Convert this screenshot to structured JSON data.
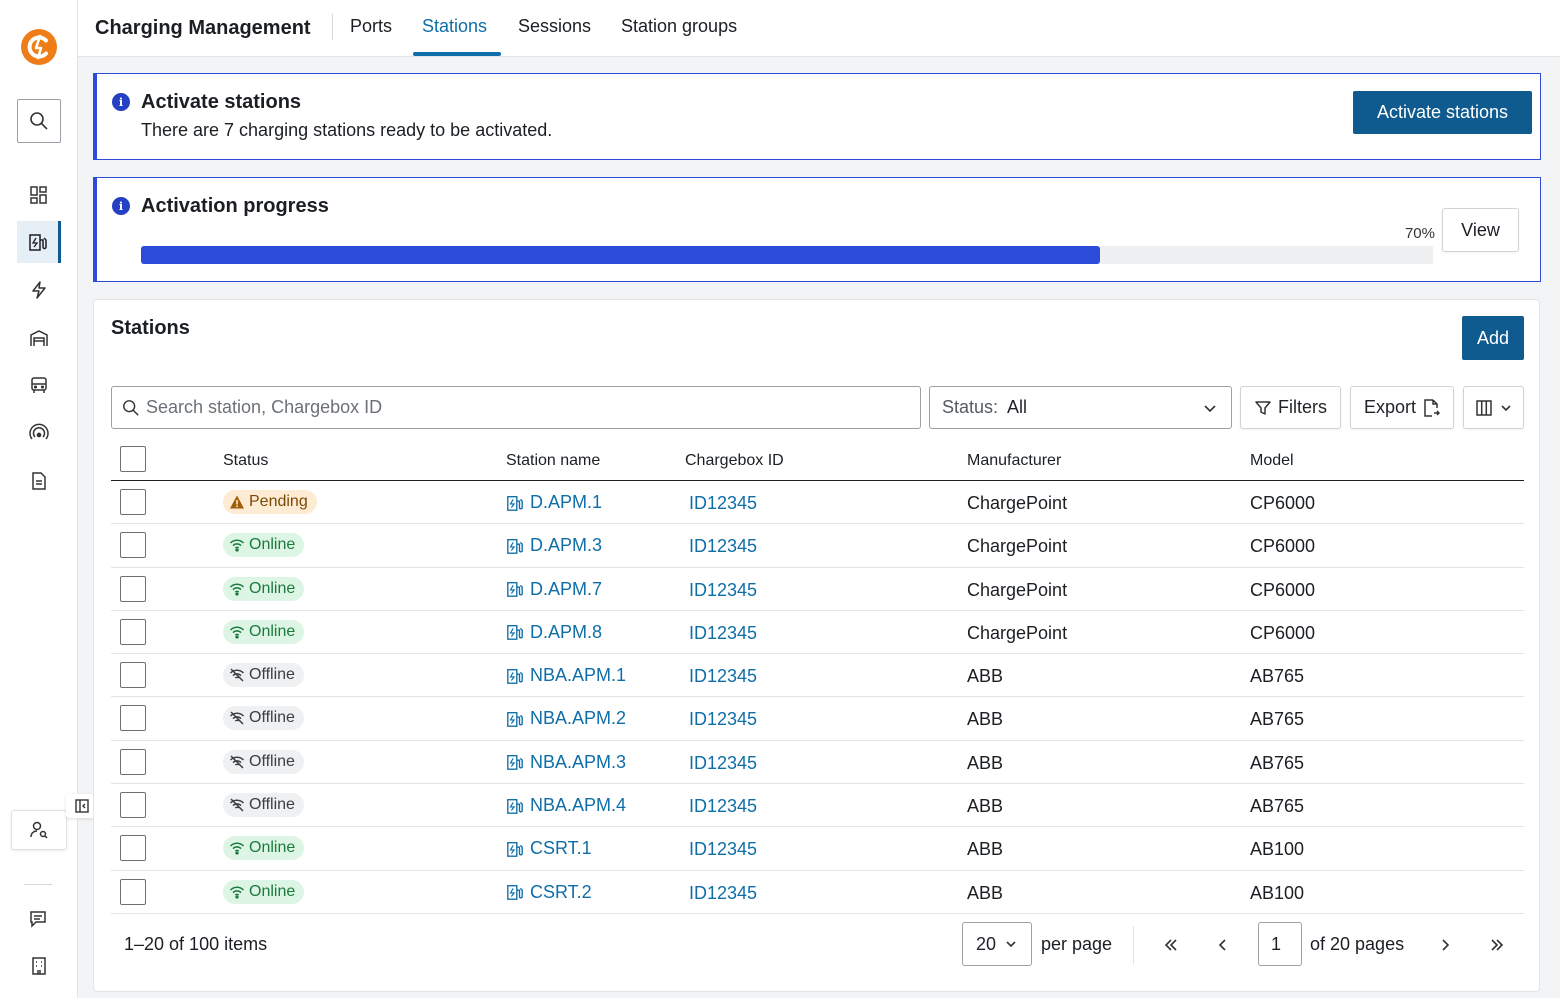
{
  "app": {
    "title": "Charging Management",
    "brand_color": "#ef7d17",
    "accent_color": "#0f5a8e"
  },
  "tabs": [
    {
      "label": "Ports",
      "active": false
    },
    {
      "label": "Stations",
      "active": true
    },
    {
      "label": "Sessions",
      "active": false
    },
    {
      "label": "Station groups",
      "active": false
    }
  ],
  "sidebar": {
    "items": [
      {
        "icon": "dashboard-icon",
        "active": false
      },
      {
        "icon": "charging-station-icon",
        "active": true
      },
      {
        "icon": "lightning-icon",
        "active": false
      },
      {
        "icon": "depot-icon",
        "active": false
      },
      {
        "icon": "bus-icon",
        "active": false
      },
      {
        "icon": "signal-icon",
        "active": false
      },
      {
        "icon": "document-icon",
        "active": false
      }
    ],
    "bottom_icons": [
      "user-search-icon",
      "feedback-icon",
      "building-icon"
    ]
  },
  "activate_notice": {
    "title": "Activate stations",
    "text": "There are 7 charging stations ready to be activated.",
    "button_label": "Activate stations"
  },
  "progress_notice": {
    "title": "Activation progress",
    "percent_label": "70%",
    "percent_value": 0.742,
    "button_label": "View"
  },
  "stations": {
    "title": "Stations",
    "add_label": "Add",
    "search_placeholder": "Search station, Chargebox ID",
    "status_label": "Status:",
    "status_value": "All",
    "filters_label": "Filters",
    "export_label": "Export",
    "columns": {
      "status": "Status",
      "station_name": "Station name",
      "chargebox_id": "Chargebox ID",
      "manufacturer": "Manufacturer",
      "model": "Model"
    },
    "rows": [
      {
        "status": "Pending",
        "kind": "pending",
        "name": "D.APM.1",
        "chargebox": "ID12345",
        "manufacturer": "ChargePoint",
        "model": "CP6000"
      },
      {
        "status": "Online",
        "kind": "online",
        "name": "D.APM.3",
        "chargebox": "ID12345",
        "manufacturer": "ChargePoint",
        "model": "CP6000"
      },
      {
        "status": "Online",
        "kind": "online",
        "name": "D.APM.7",
        "chargebox": "ID12345",
        "manufacturer": "ChargePoint",
        "model": "CP6000"
      },
      {
        "status": "Online",
        "kind": "online",
        "name": "D.APM.8",
        "chargebox": "ID12345",
        "manufacturer": "ChargePoint",
        "model": "CP6000"
      },
      {
        "status": "Offline",
        "kind": "offline",
        "name": "NBA.APM.1",
        "chargebox": "ID12345",
        "manufacturer": "ABB",
        "model": "AB765"
      },
      {
        "status": "Offline",
        "kind": "offline",
        "name": "NBA.APM.2",
        "chargebox": "ID12345",
        "manufacturer": "ABB",
        "model": "AB765"
      },
      {
        "status": "Offline",
        "kind": "offline",
        "name": "NBA.APM.3",
        "chargebox": "ID12345",
        "manufacturer": "ABB",
        "model": "AB765"
      },
      {
        "status": "Offline",
        "kind": "offline",
        "name": "NBA.APM.4",
        "chargebox": "ID12345",
        "manufacturer": "ABB",
        "model": "AB765"
      },
      {
        "status": "Online",
        "kind": "online",
        "name": "CSRT.1",
        "chargebox": "ID12345",
        "manufacturer": "ABB",
        "model": "AB100"
      },
      {
        "status": "Online",
        "kind": "online",
        "name": "CSRT.2",
        "chargebox": "ID12345",
        "manufacturer": "ABB",
        "model": "AB100"
      }
    ]
  },
  "pagination": {
    "range_label": "1–20 of 100 items",
    "per_page_value": "20",
    "per_page_label": "per page",
    "page_value": "1",
    "of_pages_label": "of 20 pages"
  }
}
